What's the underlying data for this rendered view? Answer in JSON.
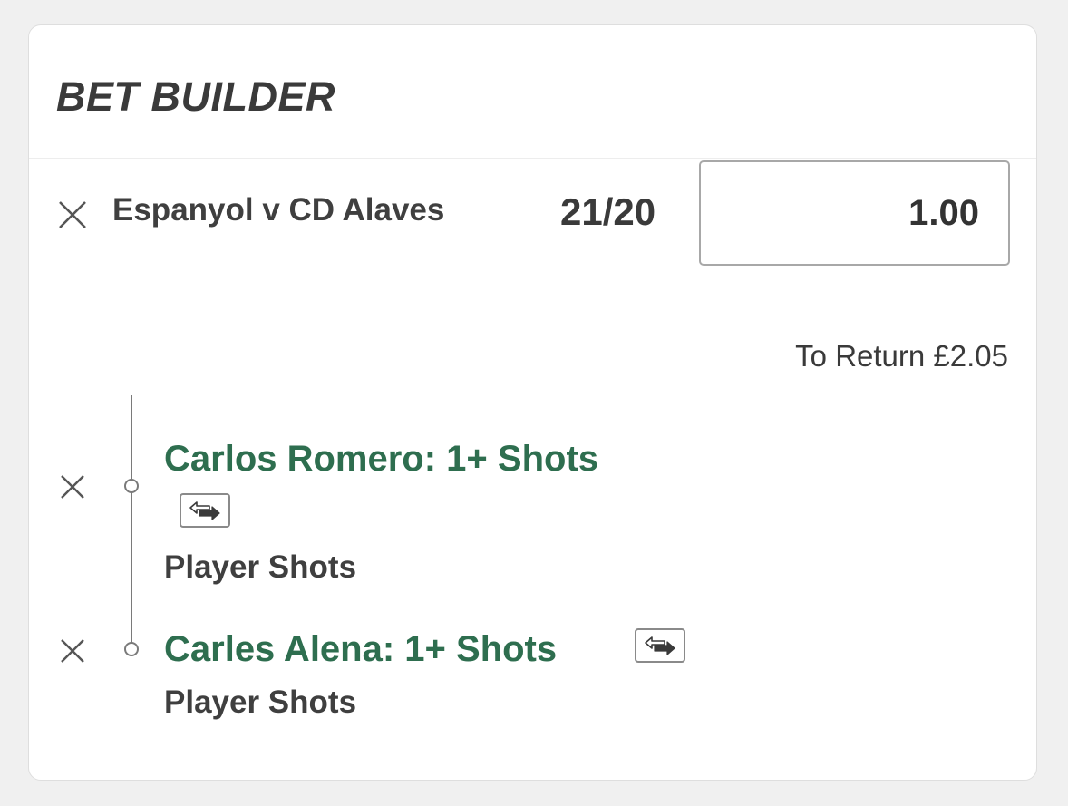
{
  "header": {
    "title": "BET BUILDER"
  },
  "bet": {
    "match": "Espanyol v CD Alaves",
    "odds": "21/20",
    "stake": "1.00",
    "to_return": "To Return £2.05"
  },
  "selections": [
    {
      "name": "Carlos Romero: 1+ Shots",
      "market": "Player Shots",
      "icon": "swap-icon"
    },
    {
      "name": "Carles Alena: 1+ Shots",
      "market": "Player Shots",
      "icon": "swap-icon"
    }
  ],
  "colors": {
    "selection_green": "#2e6e4f",
    "text_dark": "#3a3a3a",
    "background": "#f0f0f0"
  }
}
